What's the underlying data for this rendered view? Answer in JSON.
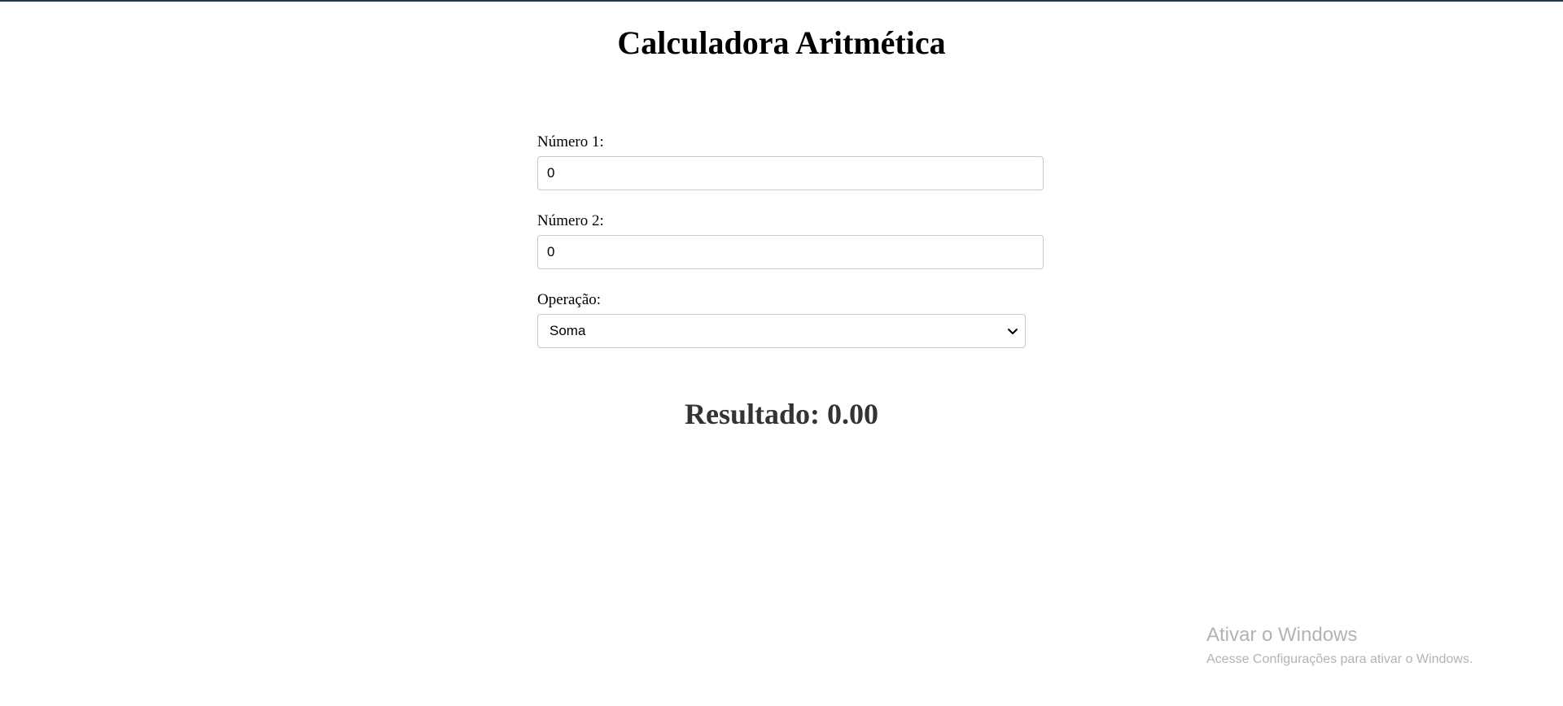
{
  "page": {
    "title": "Calculadora Aritmética"
  },
  "form": {
    "number1": {
      "label": "Número 1:",
      "value": "0"
    },
    "number2": {
      "label": "Número 2:",
      "value": "0"
    },
    "operation": {
      "label": "Operação:",
      "selected": "Soma"
    }
  },
  "result": {
    "text": "Resultado: 0.00"
  },
  "watermark": {
    "title": "Ativar o Windows",
    "subtitle": "Acesse Configurações para ativar o Windows."
  },
  "colors": {
    "top_border": "#1f3b4d",
    "result_text": "#333333",
    "input_border": "#c8c8c8",
    "watermark_text": "#b3b3b3"
  },
  "icons": {
    "select_indicator": "chevron-down-icon"
  }
}
